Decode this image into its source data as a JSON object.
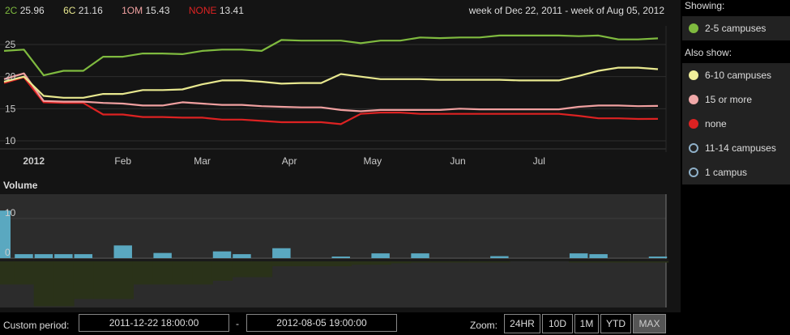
{
  "header": {
    "legend": [
      {
        "code": "2C",
        "value": "25.96",
        "color": "#7fba3f"
      },
      {
        "code": "6C",
        "value": "21.16",
        "color": "#e8e88f"
      },
      {
        "code": "1OM",
        "value": "15.43",
        "color": "#f0a0a0"
      },
      {
        "code": "NONE",
        "value": "13.41",
        "color": "#dd2222"
      }
    ],
    "date_range": "week of Dec 22, 2011 - week of Aug 05, 2012"
  },
  "panel": {
    "showing_label": "Showing:",
    "showing": [
      {
        "label": "2-5 campuses",
        "color": "#7fba3f",
        "filled": true
      }
    ],
    "also_label": "Also show:",
    "also": [
      {
        "label": "6-10 campuses",
        "color": "#f0ee9a",
        "filled": true
      },
      {
        "label": "15 or more",
        "color": "#f0a8a8",
        "filled": true
      },
      {
        "label": "none",
        "color": "#dd2222",
        "filled": true
      },
      {
        "label": "11-14 campuses",
        "color": "#8fb0c8",
        "filled": false
      },
      {
        "label": "1 campus",
        "color": "#8fb0c8",
        "filled": false
      }
    ]
  },
  "volume_label": "Volume",
  "bottom": {
    "custom_period_label": "Custom period:",
    "start": "2011-12-22 18:00:00",
    "separator": "-",
    "end": "2012-08-05 19:00:00",
    "zoom_label": "Zoom:",
    "zoom_buttons": [
      "24HR",
      "10D",
      "1M",
      "YTD",
      "MAX"
    ],
    "zoom_active": "MAX"
  },
  "chart_data": {
    "type": "line",
    "x_tick_labels": [
      "2012",
      "Feb",
      "Mar",
      "Apr",
      "May",
      "Jun",
      "Jul"
    ],
    "y_ticks": [
      10,
      15,
      20,
      25
    ],
    "ylim": [
      8,
      28
    ],
    "series": [
      {
        "name": "2C",
        "color": "#7fba3f",
        "values": [
          24.0,
          24.2,
          20.2,
          20.9,
          20.9,
          23.1,
          23.1,
          23.6,
          23.6,
          23.5,
          24.0,
          24.2,
          24.2,
          24.0,
          25.7,
          25.6,
          25.6,
          25.6,
          25.2,
          25.6,
          25.6,
          26.1,
          26.0,
          26.1,
          26.1,
          26.4,
          26.4,
          26.4,
          26.4,
          26.3,
          26.4,
          25.8,
          25.8,
          25.96
        ]
      },
      {
        "name": "6C",
        "color": "#e8e88f",
        "values": [
          19.2,
          20.0,
          17.0,
          16.7,
          16.7,
          17.3,
          17.3,
          17.9,
          17.9,
          18.0,
          18.8,
          19.4,
          19.4,
          19.2,
          18.9,
          19.0,
          19.0,
          20.4,
          20.0,
          19.6,
          19.6,
          19.6,
          19.5,
          19.5,
          19.5,
          19.5,
          19.4,
          19.4,
          19.4,
          20.1,
          20.9,
          21.4,
          21.4,
          21.16
        ]
      },
      {
        "name": "1OM",
        "color": "#f0a0a0",
        "values": [
          19.6,
          20.5,
          16.2,
          16.1,
          16.1,
          15.9,
          15.8,
          15.5,
          15.5,
          16.0,
          15.8,
          15.6,
          15.6,
          15.4,
          15.3,
          15.2,
          15.2,
          14.8,
          14.6,
          14.8,
          14.8,
          14.8,
          14.8,
          15.0,
          14.9,
          14.9,
          14.9,
          14.9,
          14.9,
          15.3,
          15.5,
          15.5,
          15.4,
          15.43
        ]
      },
      {
        "name": "NONE",
        "color": "#dd2222",
        "values": [
          19.0,
          19.9,
          16.0,
          15.9,
          15.9,
          14.1,
          14.1,
          13.7,
          13.7,
          13.6,
          13.6,
          13.3,
          13.3,
          13.1,
          12.9,
          12.9,
          12.9,
          12.6,
          14.2,
          14.4,
          14.4,
          14.2,
          14.2,
          14.2,
          14.2,
          14.2,
          14.2,
          14.2,
          14.2,
          13.9,
          13.5,
          13.5,
          13.4,
          13.41
        ]
      }
    ],
    "volume": {
      "y_ticks": [
        0,
        10
      ],
      "ylim": [
        0,
        14
      ],
      "values": [
        12,
        1,
        1,
        1,
        1,
        0,
        3.2,
        0,
        1.3,
        0,
        0,
        1.7,
        1,
        0,
        2.5,
        0,
        0,
        0.4,
        0,
        1.2,
        0,
        1.2,
        0,
        0,
        0,
        0.5,
        0,
        0,
        0,
        1.2,
        1,
        0,
        0,
        0.4
      ],
      "net": [
        -3.5,
        -3.5,
        -6.5,
        -6.5,
        -5.5,
        -5.5,
        -5.5,
        -3.5,
        -3.5,
        -3.5,
        -3.5,
        -3.0,
        -2.5,
        -2.5,
        -1.0,
        -1.0,
        -1.0,
        -1.0,
        -0.8,
        -0.8,
        -0.6,
        -0.5,
        -0.5,
        -0.5,
        -0.5,
        -0.5,
        -0.3,
        -0.3,
        -0.3,
        -0.5,
        -0.5,
        -0.5,
        -0.5,
        -0.5
      ]
    }
  }
}
